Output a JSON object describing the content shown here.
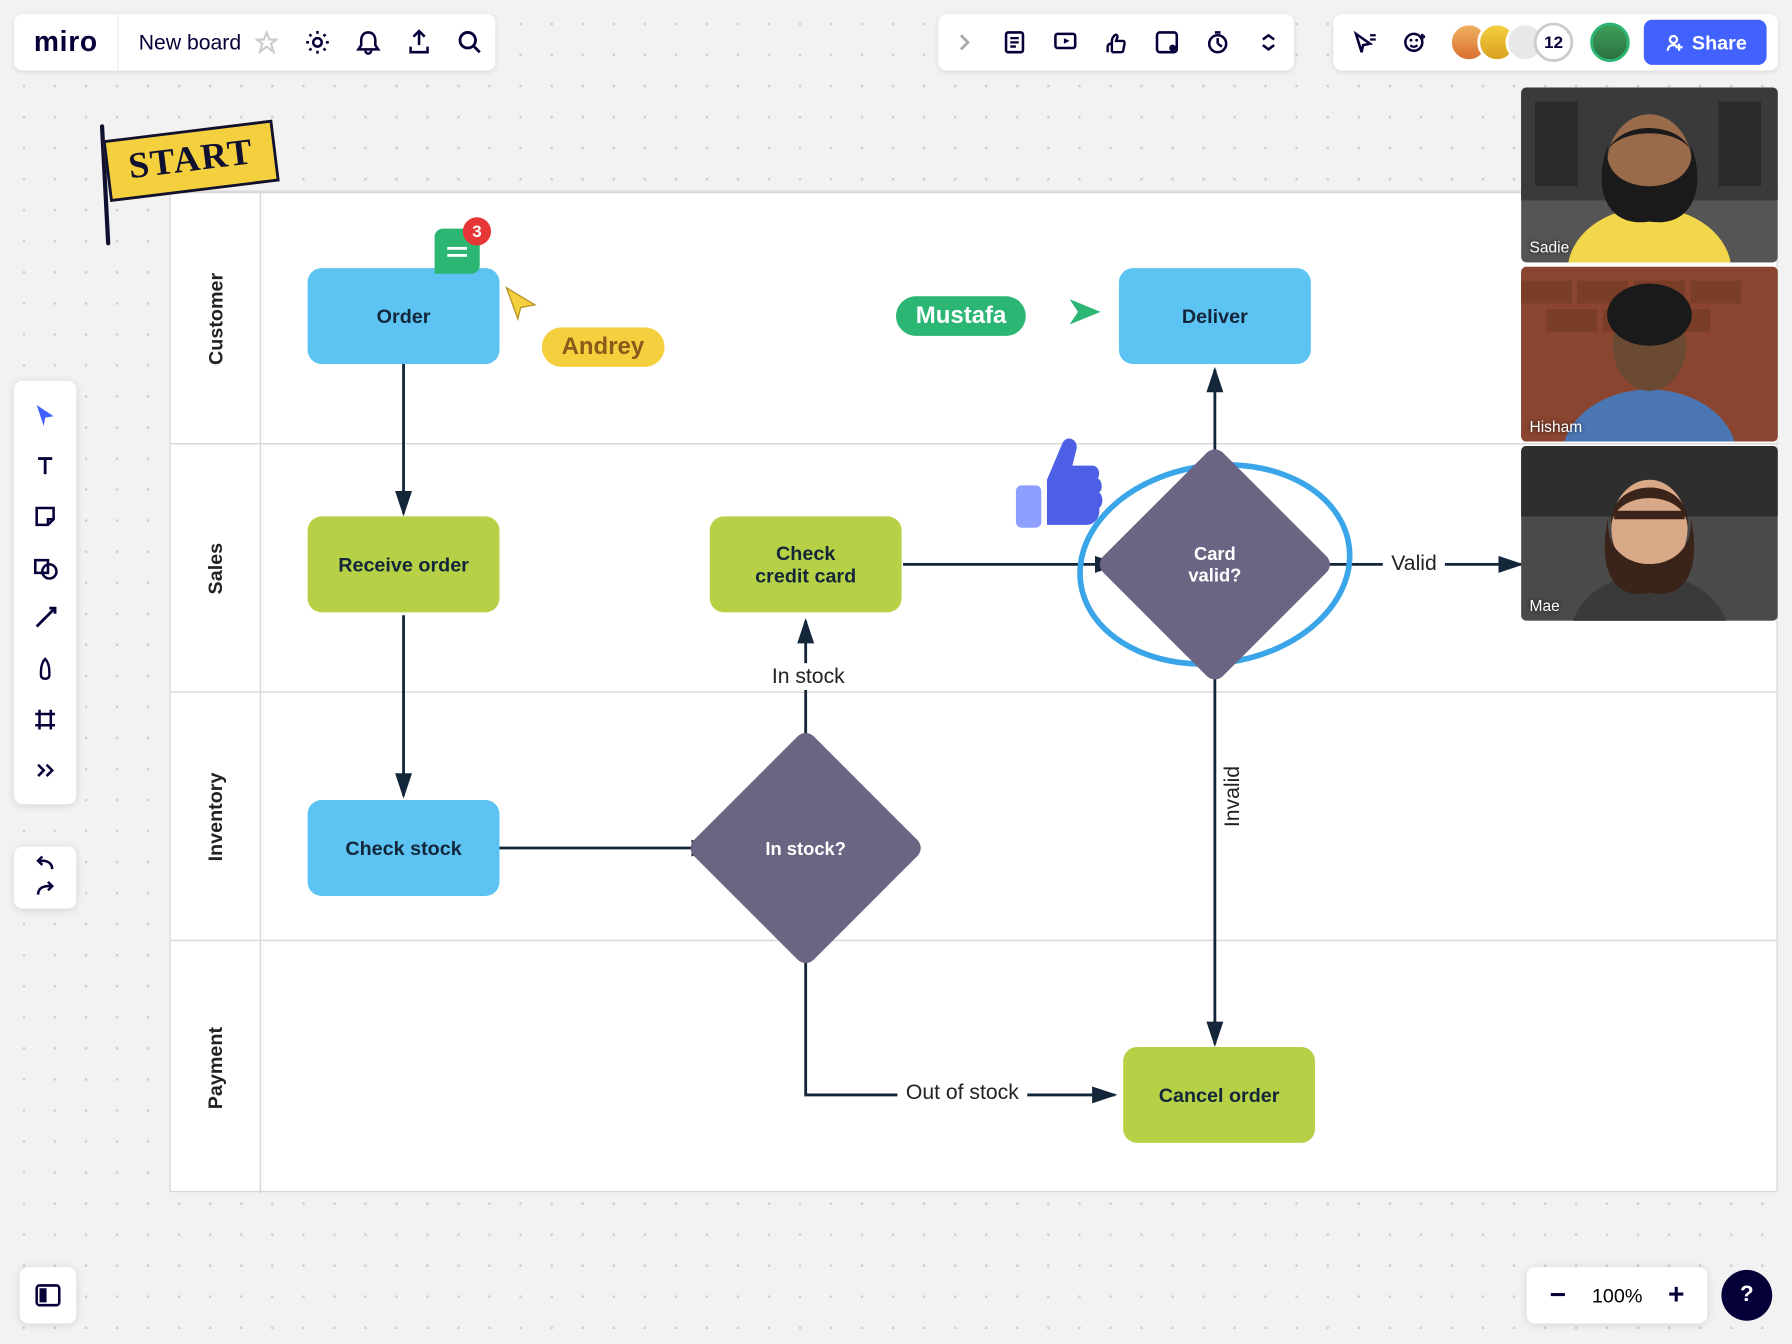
{
  "brand": "miro",
  "board_name": "New board",
  "share_label": "Share",
  "participant_count": "12",
  "zoom": "100%",
  "help": "?",
  "start_flag": "START",
  "lanes": [
    {
      "id": "customer",
      "label": "Customer"
    },
    {
      "id": "sales",
      "label": "Sales"
    },
    {
      "id": "inventory",
      "label": "Inventory"
    },
    {
      "id": "payment",
      "label": "Payment"
    }
  ],
  "nodes": {
    "order": "Order",
    "deliver": "Deliver",
    "receive_order": "Receive order",
    "check_credit": "Check\ncredit card",
    "card_valid": "Card\nvalid?",
    "check_stock": "Check stock",
    "in_stock_q": "In stock?",
    "cancel_order": "Cancel order"
  },
  "edge_labels": {
    "valid": "Valid",
    "invalid": "Invalid",
    "in_stock": "In stock",
    "out_of_stock": "Out of stock"
  },
  "cursors": {
    "andrey": "Andrey",
    "mustafa": "Mustafa"
  },
  "comment_badge": "3",
  "video_participants": [
    {
      "name": "Sadie",
      "bg": "#2b2b2b",
      "shirt": "#f2d64b",
      "skin": "#9a6b4a",
      "hair": "#1a1a1a"
    },
    {
      "name": "Hisham",
      "bg": "#a8573d",
      "shirt": "#4a77b3",
      "skin": "#6b4a33",
      "hair": "#1a1a1a"
    },
    {
      "name": "Mae",
      "bg": "#3a3a3a",
      "shirt": "#4a4a4a",
      "skin": "#d9a887",
      "hair": "#3a241a"
    }
  ]
}
